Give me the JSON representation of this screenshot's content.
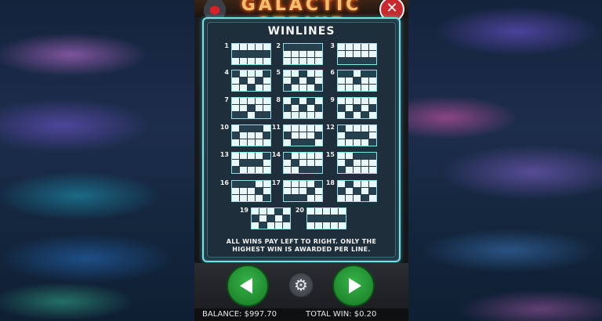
{
  "header": {
    "game_title": "GALACTIC STRIKE",
    "logo_icon": "red-cube-icon",
    "close_label": "✕"
  },
  "winlines": {
    "title": "WINLINES",
    "lines": [
      {
        "n": "1",
        "rows": [
          [
            0,
            0,
            0,
            0,
            0
          ],
          [
            1,
            1,
            1,
            1,
            1
          ],
          [
            0,
            0,
            0,
            0,
            0
          ]
        ]
      },
      {
        "n": "2",
        "rows": [
          [
            1,
            1,
            1,
            1,
            1
          ],
          [
            0,
            0,
            0,
            0,
            0
          ],
          [
            0,
            0,
            0,
            0,
            0
          ]
        ]
      },
      {
        "n": "3",
        "rows": [
          [
            0,
            0,
            0,
            0,
            0
          ],
          [
            0,
            0,
            0,
            0,
            0
          ],
          [
            1,
            1,
            1,
            1,
            1
          ]
        ]
      },
      {
        "n": "4",
        "rows": [
          [
            1,
            0,
            0,
            0,
            1
          ],
          [
            0,
            1,
            0,
            1,
            0
          ],
          [
            0,
            0,
            1,
            0,
            0
          ]
        ]
      },
      {
        "n": "5",
        "rows": [
          [
            0,
            0,
            1,
            0,
            0
          ],
          [
            0,
            1,
            0,
            1,
            0
          ],
          [
            1,
            0,
            0,
            0,
            1
          ]
        ]
      },
      {
        "n": "6",
        "rows": [
          [
            1,
            1,
            0,
            1,
            1
          ],
          [
            0,
            0,
            1,
            0,
            0
          ],
          [
            0,
            0,
            0,
            0,
            0
          ]
        ]
      },
      {
        "n": "7",
        "rows": [
          [
            0,
            0,
            0,
            0,
            0
          ],
          [
            0,
            0,
            1,
            0,
            0
          ],
          [
            1,
            1,
            0,
            1,
            1
          ]
        ]
      },
      {
        "n": "8",
        "rows": [
          [
            0,
            1,
            0,
            1,
            0
          ],
          [
            1,
            0,
            1,
            0,
            1
          ],
          [
            0,
            0,
            0,
            0,
            0
          ]
        ]
      },
      {
        "n": "9",
        "rows": [
          [
            0,
            0,
            0,
            0,
            0
          ],
          [
            1,
            0,
            1,
            0,
            1
          ],
          [
            0,
            1,
            0,
            1,
            0
          ]
        ]
      },
      {
        "n": "10",
        "rows": [
          [
            0,
            1,
            1,
            1,
            0
          ],
          [
            1,
            0,
            0,
            0,
            1
          ],
          [
            0,
            0,
            0,
            0,
            0
          ]
        ]
      },
      {
        "n": "11",
        "rows": [
          [
            0,
            0,
            0,
            0,
            0
          ],
          [
            1,
            0,
            0,
            0,
            1
          ],
          [
            0,
            1,
            1,
            1,
            0
          ]
        ]
      },
      {
        "n": "12",
        "rows": [
          [
            1,
            0,
            0,
            0,
            0
          ],
          [
            0,
            1,
            1,
            1,
            0
          ],
          [
            0,
            0,
            0,
            0,
            1
          ]
        ]
      },
      {
        "n": "13",
        "rows": [
          [
            0,
            0,
            0,
            0,
            1
          ],
          [
            0,
            1,
            1,
            1,
            0
          ],
          [
            1,
            0,
            0,
            0,
            0
          ]
        ]
      },
      {
        "n": "14",
        "rows": [
          [
            1,
            0,
            0,
            0,
            0
          ],
          [
            0,
            1,
            0,
            0,
            0
          ],
          [
            0,
            0,
            1,
            1,
            1
          ]
        ]
      },
      {
        "n": "15",
        "rows": [
          [
            0,
            0,
            1,
            1,
            1
          ],
          [
            0,
            1,
            0,
            0,
            0
          ],
          [
            1,
            0,
            0,
            0,
            0
          ]
        ]
      },
      {
        "n": "16",
        "rows": [
          [
            1,
            1,
            1,
            0,
            0
          ],
          [
            0,
            0,
            0,
            1,
            0
          ],
          [
            0,
            0,
            0,
            0,
            1
          ]
        ]
      },
      {
        "n": "17",
        "rows": [
          [
            0,
            0,
            0,
            0,
            1
          ],
          [
            0,
            0,
            0,
            1,
            0
          ],
          [
            1,
            1,
            1,
            0,
            0
          ]
        ]
      },
      {
        "n": "18",
        "rows": [
          [
            0,
            1,
            0,
            0,
            0
          ],
          [
            1,
            0,
            1,
            0,
            1
          ],
          [
            0,
            0,
            0,
            1,
            0
          ]
        ]
      },
      {
        "n": "19",
        "rows": [
          [
            0,
            0,
            0,
            1,
            0
          ],
          [
            1,
            0,
            1,
            0,
            1
          ],
          [
            0,
            1,
            0,
            0,
            0
          ]
        ]
      },
      {
        "n": "20",
        "rows": [
          [
            0,
            0,
            0,
            0,
            0
          ],
          [
            1,
            1,
            1,
            1,
            1
          ],
          [
            0,
            0,
            0,
            0,
            0
          ]
        ]
      }
    ],
    "footer_line1": "ALL WINS PAY LEFT TO RIGHT. ONLY THE",
    "footer_line2": "HIGHEST WIN IS AWARDED PER LINE."
  },
  "controls": {
    "prev_icon": "left-arrow-icon",
    "settings_icon": "gear-icon",
    "next_icon": "right-arrow-icon",
    "gear_glyph": "⚙"
  },
  "status": {
    "balance": "BALANCE: $997.70",
    "total_win": "TOTAL WIN: $0.20"
  },
  "colors": {
    "accent": "#6ee2ea",
    "button_green": "#1f8a2e",
    "close_red": "#c8282e"
  }
}
